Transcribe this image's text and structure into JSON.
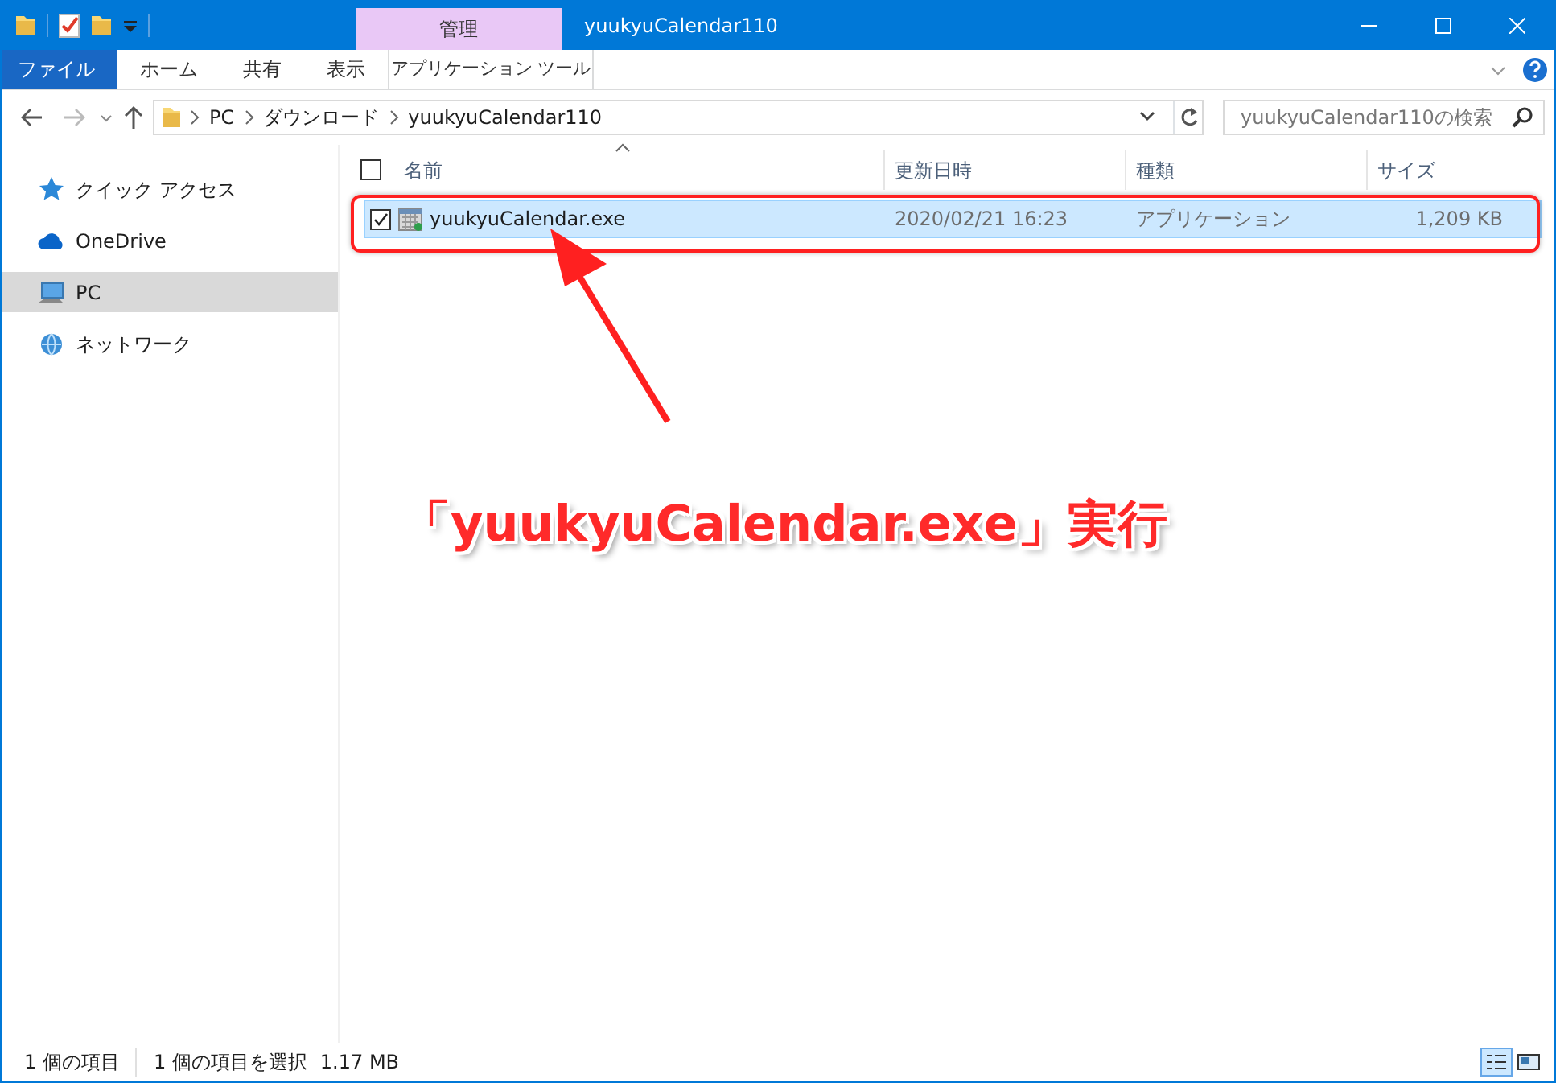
{
  "title_bar": {
    "contextual_tab": "管理",
    "title": "yuukyuCalendar110"
  },
  "ribbon_tabs": [
    {
      "label": "ファイル",
      "kind": "file"
    },
    {
      "label": "ホーム",
      "kind": "tab"
    },
    {
      "label": "共有",
      "kind": "tab"
    },
    {
      "label": "表示",
      "kind": "tab"
    },
    {
      "label": "アプリケーション ツール",
      "kind": "contextual"
    }
  ],
  "address_bar": {
    "path": [
      "PC",
      "ダウンロード",
      "yuukyuCalendar110"
    ]
  },
  "search": {
    "placeholder": "yuukyuCalendar110の検索"
  },
  "sidebar": {
    "items": [
      {
        "label": "クイック アクセス",
        "kind": "star",
        "selected": false
      },
      {
        "label": "OneDrive",
        "kind": "cloud",
        "selected": false
      },
      {
        "label": "PC",
        "kind": "pc",
        "selected": true
      },
      {
        "label": "ネットワーク",
        "kind": "network",
        "selected": false
      }
    ]
  },
  "table": {
    "select_all_checked": false,
    "columns": [
      {
        "label": "名前",
        "sorted": true
      },
      {
        "label": "更新日時",
        "sorted": false
      },
      {
        "label": "種類",
        "sorted": false
      },
      {
        "label": "サイズ",
        "sorted": false
      }
    ],
    "rows": [
      {
        "name": "yuukyuCalendar.exe",
        "modified": "2020/02/21 16:23",
        "type": "アプリケーション",
        "size": "1,209 KB",
        "selected": true,
        "checked": true
      }
    ]
  },
  "annotation": {
    "text": "「yuukyuCalendar.exe」実行"
  },
  "status_bar": {
    "item_count": "1 個の項目",
    "selection": "1 個の項目を選択",
    "size": "1.17 MB"
  },
  "views": [
    {
      "kind": "details",
      "selected": true
    },
    {
      "kind": "tiles",
      "selected": false
    }
  ]
}
